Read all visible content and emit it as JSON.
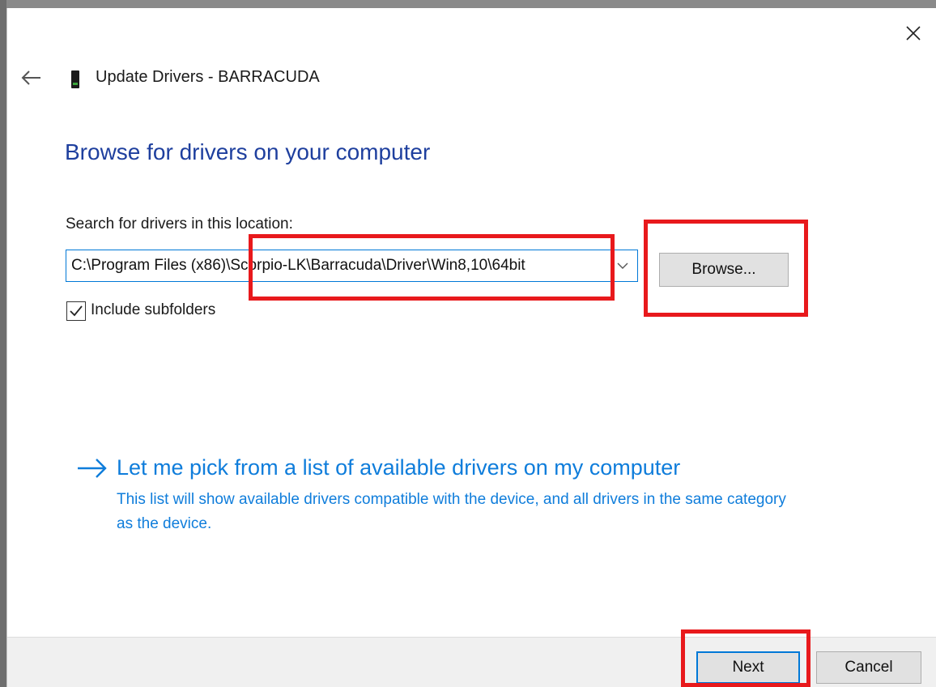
{
  "window": {
    "title": "Update Drivers - BARRACUDA",
    "close_icon": "close-icon",
    "back_icon": "back-arrow-icon",
    "device_icon": "device-icon"
  },
  "main": {
    "heading": "Browse for drivers on your computer",
    "search_label": "Search for drivers in this location:",
    "path_value": "C:\\Program Files (x86)\\Scorpio-LK\\Barracuda\\Driver\\Win8,10\\64bit",
    "dropdown_icon": "chevron-down-icon",
    "browse_label": "Browse...",
    "include_subfolders_label": "Include subfolders",
    "include_subfolders_checked": true,
    "pick_link_title": "Let me pick from a list of available drivers on my computer",
    "pick_link_description": "This list will show available drivers compatible with the device, and all drivers in the same category as the device."
  },
  "footer": {
    "next_label": "Next",
    "cancel_label": "Cancel"
  },
  "colors": {
    "heading": "#1e3f9e",
    "link": "#0f7ddb",
    "focus": "#0078d7",
    "highlight": "#e8191c"
  }
}
